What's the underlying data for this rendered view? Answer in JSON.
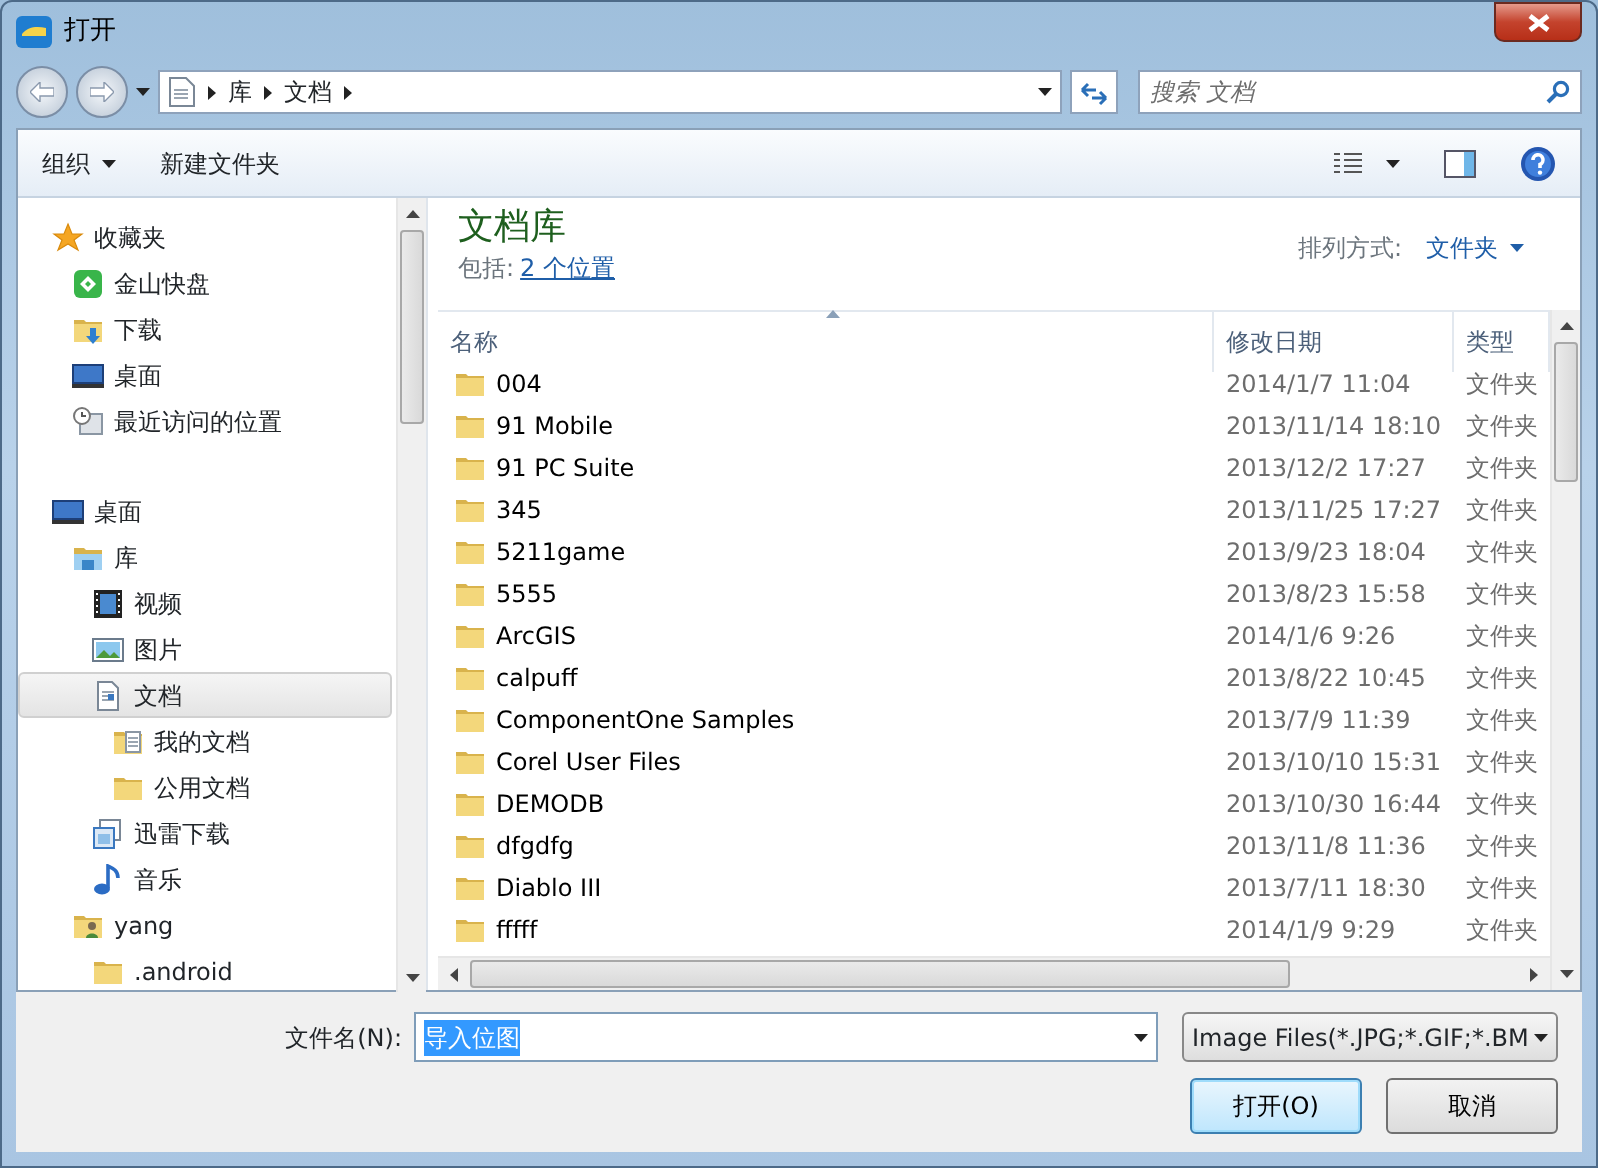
{
  "window": {
    "title": "打开"
  },
  "address": {
    "crumbs": [
      "库",
      "文档"
    ],
    "search_placeholder": "搜索 文档"
  },
  "toolbar": {
    "organize": "组织",
    "new_folder": "新建文件夹"
  },
  "sidebar": {
    "items": [
      {
        "label": "收藏夹",
        "kind": "star",
        "selected": false,
        "children": [
          {
            "label": "金山快盘",
            "kind": "cloud",
            "selected": false
          },
          {
            "label": "下载",
            "kind": "download",
            "selected": false
          },
          {
            "label": "桌面",
            "kind": "desktop",
            "selected": false
          },
          {
            "label": "最近访问的位置",
            "kind": "recent",
            "selected": false
          }
        ]
      },
      {
        "label": "桌面",
        "kind": "desktop",
        "selected": false,
        "children": [
          {
            "label": "库",
            "kind": "library",
            "selected": false,
            "children": [
              {
                "label": "视频",
                "kind": "video",
                "selected": false
              },
              {
                "label": "图片",
                "kind": "picture",
                "selected": false
              },
              {
                "label": "文档",
                "kind": "document",
                "selected": true,
                "children": [
                  {
                    "label": "我的文档",
                    "kind": "docfolder",
                    "selected": false
                  },
                  {
                    "label": "公用文档",
                    "kind": "folder",
                    "selected": false
                  }
                ]
              },
              {
                "label": "迅雷下载",
                "kind": "xunlei",
                "selected": false
              },
              {
                "label": "音乐",
                "kind": "music",
                "selected": false
              }
            ]
          },
          {
            "label": "yang",
            "kind": "user",
            "selected": false,
            "children": [
              {
                "label": ".android",
                "kind": "folder",
                "selected": false
              }
            ]
          }
        ]
      }
    ]
  },
  "library": {
    "title": "文档库",
    "includes_label": "包括:",
    "includes_link": "2 个位置",
    "arrange_label": "排列方式:",
    "arrange_value": "文件夹"
  },
  "table": {
    "columns": [
      "名称",
      "修改日期",
      "类型"
    ],
    "rows": [
      {
        "name": "004",
        "date": "2014/1/7 11:04",
        "type": "文件夹"
      },
      {
        "name": "91 Mobile",
        "date": "2013/11/14 18:10",
        "type": "文件夹"
      },
      {
        "name": "91 PC Suite",
        "date": "2013/12/2 17:27",
        "type": "文件夹"
      },
      {
        "name": "345",
        "date": "2013/11/25 17:27",
        "type": "文件夹"
      },
      {
        "name": "5211game",
        "date": "2013/9/23 18:04",
        "type": "文件夹"
      },
      {
        "name": "5555",
        "date": "2013/8/23 15:58",
        "type": "文件夹"
      },
      {
        "name": "ArcGIS",
        "date": "2014/1/6 9:26",
        "type": "文件夹"
      },
      {
        "name": "calpuff",
        "date": "2013/8/22 10:45",
        "type": "文件夹"
      },
      {
        "name": "ComponentOne Samples",
        "date": "2013/7/9 11:39",
        "type": "文件夹"
      },
      {
        "name": "Corel User Files",
        "date": "2013/10/10 15:31",
        "type": "文件夹"
      },
      {
        "name": "DEMODB",
        "date": "2013/10/30 16:44",
        "type": "文件夹"
      },
      {
        "name": "dfgdfg",
        "date": "2013/11/8 11:36",
        "type": "文件夹"
      },
      {
        "name": "Diablo III",
        "date": "2013/7/11 18:30",
        "type": "文件夹"
      },
      {
        "name": "fffff",
        "date": "2014/1/9 9:29",
        "type": "文件夹"
      }
    ]
  },
  "footer": {
    "filename_label": "文件名(N):",
    "filename_value": "导入位图",
    "filter": "Image Files(*.JPG;*.GIF;*.BM",
    "open_button": "打开(O)",
    "cancel_button": "取消"
  }
}
